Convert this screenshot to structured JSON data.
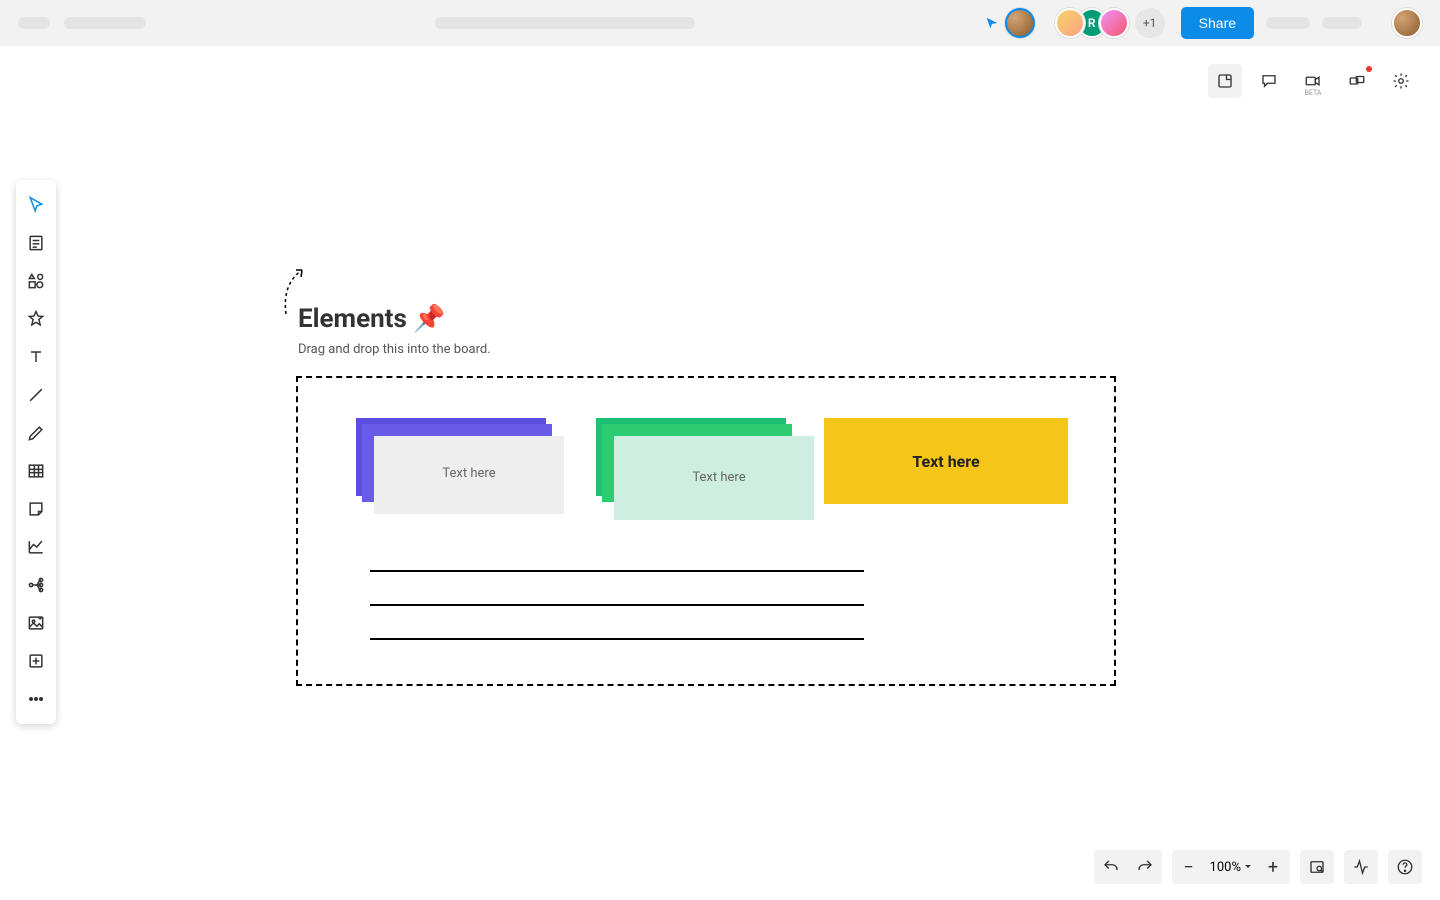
{
  "topbar": {
    "more_count": "+1",
    "share_label": "Share",
    "collab_initial": "R"
  },
  "top_right": {
    "beta_label": "BETA"
  },
  "canvas": {
    "heading": "Elements 📌",
    "subheading": "Drag and drop this into the board.",
    "card1_text": "Text here",
    "card2_text": "Text here",
    "card3_text": "Text here"
  },
  "bottom": {
    "zoom": "100%"
  }
}
